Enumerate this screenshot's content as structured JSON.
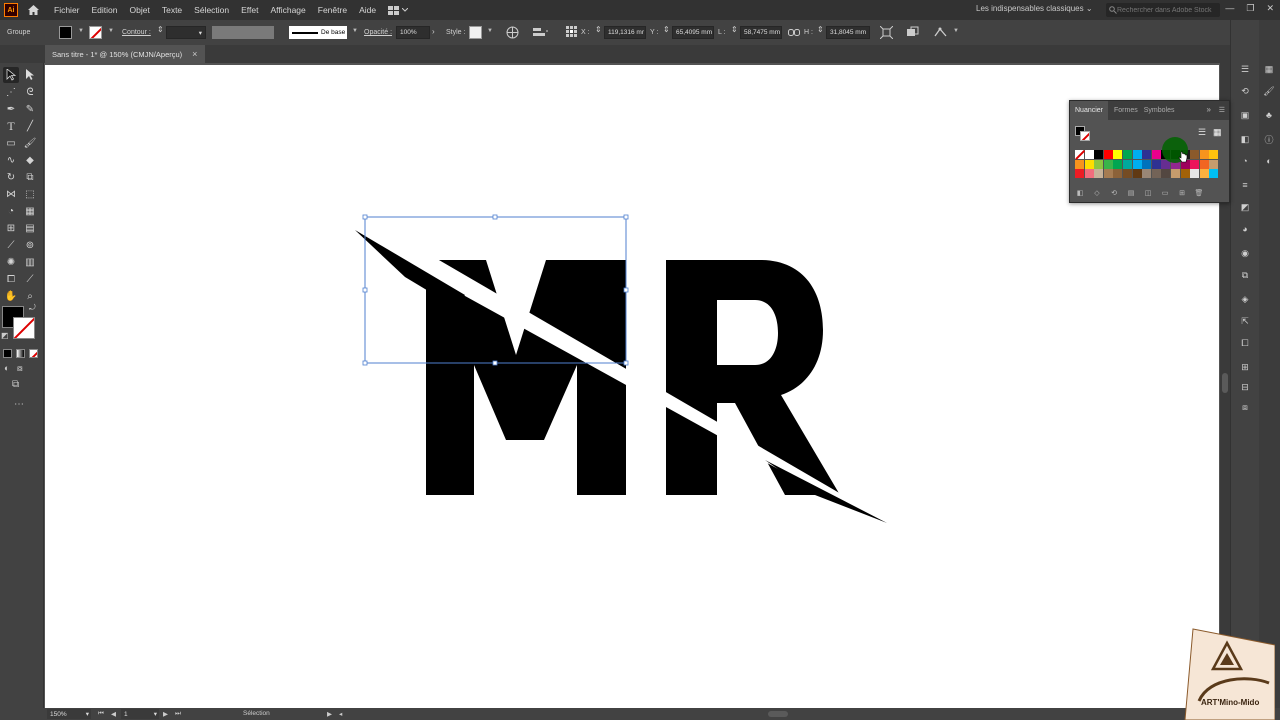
{
  "menubar": {
    "logo": "Ai",
    "items": [
      "Fichier",
      "Edition",
      "Objet",
      "Texte",
      "Sélection",
      "Effet",
      "Affichage",
      "Fenêtre",
      "Aide"
    ],
    "workspace": "Les indispensables classiques",
    "search_placeholder": "Rechercher dans Adobe Stock"
  },
  "controlbar": {
    "selection_type": "Groupe",
    "contour_label": "Contour :",
    "stroke_profile": "De base",
    "opacity_label": "Opacité :",
    "opacity_value": "100%",
    "style_label": "Style :",
    "x_label": "X :",
    "x_value": "119,1316 mr",
    "y_label": "Y :",
    "y_value": "65,4095 mm",
    "w_label": "L :",
    "w_value": "58,7475 mm",
    "h_label": "H :",
    "h_value": "31,8045 mm"
  },
  "document": {
    "tab_title": "Sans titre - 1* @ 150% (CMJN/Aperçu)",
    "close": "×"
  },
  "swatches_panel": {
    "tabs": [
      "Nuancier",
      "Formes",
      "Symboles"
    ],
    "collapse": "»",
    "colors": {
      "row1": [
        "#ffffff",
        "#ffffff",
        "#000000",
        "#ff0000",
        "#ffff00",
        "#00a651",
        "#00aeef",
        "#2e3192",
        "#ec008c",
        "#000000",
        "#000000",
        "#1a1a1a",
        "#8b5a2b",
        "#f7941d",
        "#ffc20e"
      ],
      "row2": [
        "#f7941d",
        "#ffde00",
        "#8dc63f",
        "#39b54a",
        "#00a651",
        "#00a99d",
        "#00aeef",
        "#0072bc",
        "#2e3192",
        "#662d91",
        "#92278f",
        "#9e005d",
        "#ed145b",
        "#f26522",
        "#c69c6d"
      ],
      "row3": [
        "#ed1c24",
        "#f26d7d",
        "#c7b299",
        "#a67c52",
        "#8c6239",
        "#754c24",
        "#603913",
        "#998675",
        "#736357",
        "#534741",
        "#c69c6d",
        "#a36209",
        "#e6e6e6",
        "#fbb040",
        "#00bff3"
      ]
    }
  },
  "statusbar": {
    "zoom": "150%",
    "artboard": "1",
    "tool": "Sélection"
  },
  "artwork": {
    "letters": "MR"
  },
  "watermark": {
    "text": "ART'Mino-Mido"
  }
}
